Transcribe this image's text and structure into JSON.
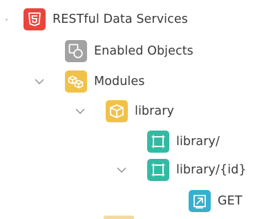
{
  "tree": {
    "items": [
      {
        "label": "RESTful Data Services",
        "icon": "restful-services-icon",
        "expanded": true,
        "color": "#e8453c"
      },
      {
        "label": "Enabled Objects",
        "icon": "enabled-objects-icon",
        "expanded": false,
        "color": "#a2a2a2"
      },
      {
        "label": "Modules",
        "icon": "modules-icon",
        "expanded": true,
        "color": "#f1c24a"
      },
      {
        "label": "library",
        "icon": "module-box-icon",
        "expanded": true,
        "color": "#f1c24a"
      },
      {
        "label": "library/",
        "icon": "template-icon",
        "expanded": false,
        "color": "#34b9a2"
      },
      {
        "label": "library/{id}",
        "icon": "template-icon",
        "expanded": true,
        "color": "#34b9a2"
      },
      {
        "label": "GET",
        "icon": "handler-icon",
        "expanded": false,
        "color": "#38aed0"
      }
    ]
  }
}
